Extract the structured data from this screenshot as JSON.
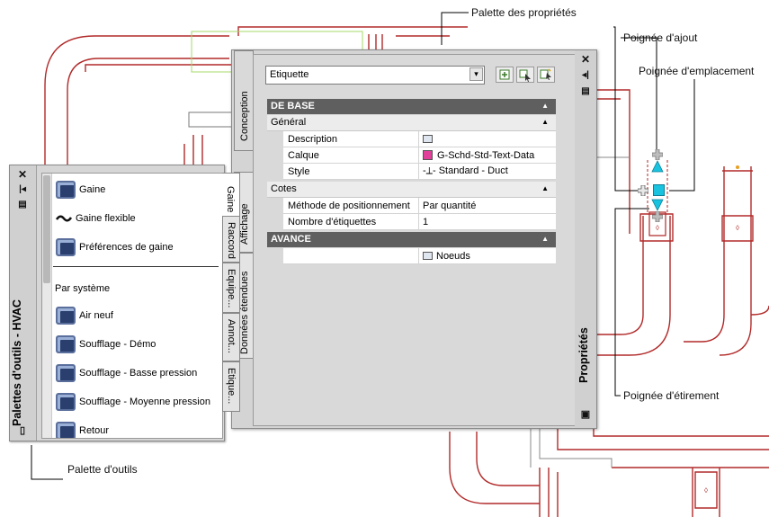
{
  "callouts": {
    "properties_palette": "Palette des propriétés",
    "add_grip": "Poignée d'ajout",
    "location_grip": "Poignée d'emplacement",
    "stretch_grip": "Poignée d'étirement",
    "tool_palette": "Palette d'outils"
  },
  "tool_palette": {
    "title": "Palettes d'outils - HVAC",
    "items_top": [
      "Gaine",
      "Gaine flexible",
      "Préférences de gaine"
    ],
    "section_label": "Par système",
    "items_system": [
      "Air neuf",
      "Soufflage - Démo",
      "Soufflage - Basse pression",
      "Soufflage - Moyenne pression",
      "Retour"
    ],
    "tabs": [
      "Gaine",
      "Raccord",
      "Equipe...",
      "Annot...",
      "Etique..."
    ]
  },
  "properties_palette": {
    "title": "Propriétés",
    "combo_value": "Etiquette",
    "side_tabs": [
      "Conception",
      "Affichage",
      "Données étendues"
    ],
    "categories": {
      "base": "DE BASE",
      "general": "Général",
      "dimensions": "Cotes",
      "advanced": "AVANCE"
    },
    "general_rows": [
      {
        "name": "Description",
        "value": ""
      },
      {
        "name": "Calque",
        "value": "G-Schd-Std-Text-Data"
      },
      {
        "name": "Style",
        "value": "-⟂- Standard - Duct"
      }
    ],
    "dimension_rows": [
      {
        "name": "Méthode de positionnement",
        "value": "Par quantité"
      },
      {
        "name": "Nombre d'étiquettes",
        "value": "1"
      }
    ],
    "advanced_row_value": "Noeuds"
  },
  "colors": {
    "duct_red": "#b22a2a",
    "grip_cyan": "#19c3e0",
    "category_bg": "#5f5f5f",
    "layer_swatch": "#e0409a"
  }
}
